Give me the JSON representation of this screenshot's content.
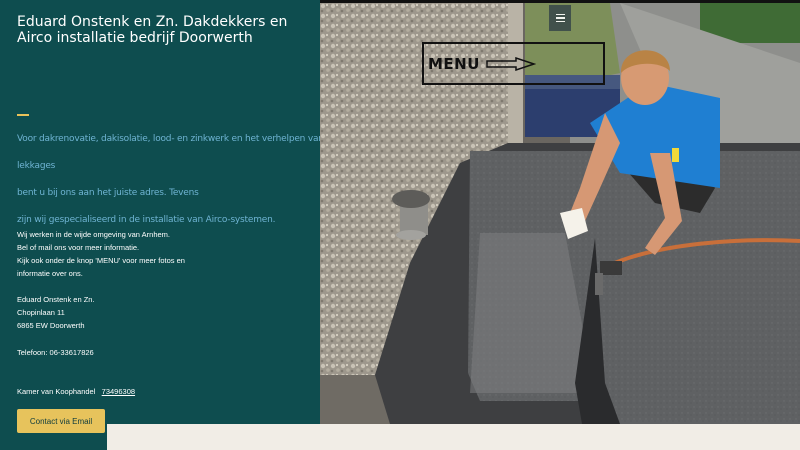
{
  "header": {
    "title": "Eduard Onstenk en Zn. Dakdekkers en Airco installatie bedrijf Doorwerth"
  },
  "intro": {
    "line1": "Voor dakrenovatie, dakisolatie, lood- en zinkwerk en het verhelpen van",
    "line2": "lekkages",
    "line3": "bent u bij ons aan het juiste adres. Tevens",
    "line4": "zijn wij gespecialiseerd in de installatie van Airco-systemen."
  },
  "info": {
    "line1": "Wij werken in de wijde omgeving van Arnhem.",
    "line2": "Bel of mail ons voor meer informatie.",
    "line3": "Kijk ook onder de knop 'MENU' voor meer fotos en",
    "line4": "informatie over ons."
  },
  "address": {
    "name": "Eduard Onstenk en Zn.",
    "street": "Chopinlaan 11",
    "city": "6865 EW  Doorwerth"
  },
  "phone": "Telefoon: 06-33617826",
  "kvk": {
    "label": "Kamer van Koophandel",
    "number": "73496308"
  },
  "contact_button": "Contact via Email",
  "menu": {
    "label": "MENU",
    "icon": "hamburger-icon"
  },
  "colors": {
    "panel": "#0e4d4f",
    "accent": "#e7c35c",
    "intro_text": "#6fb4d3"
  }
}
